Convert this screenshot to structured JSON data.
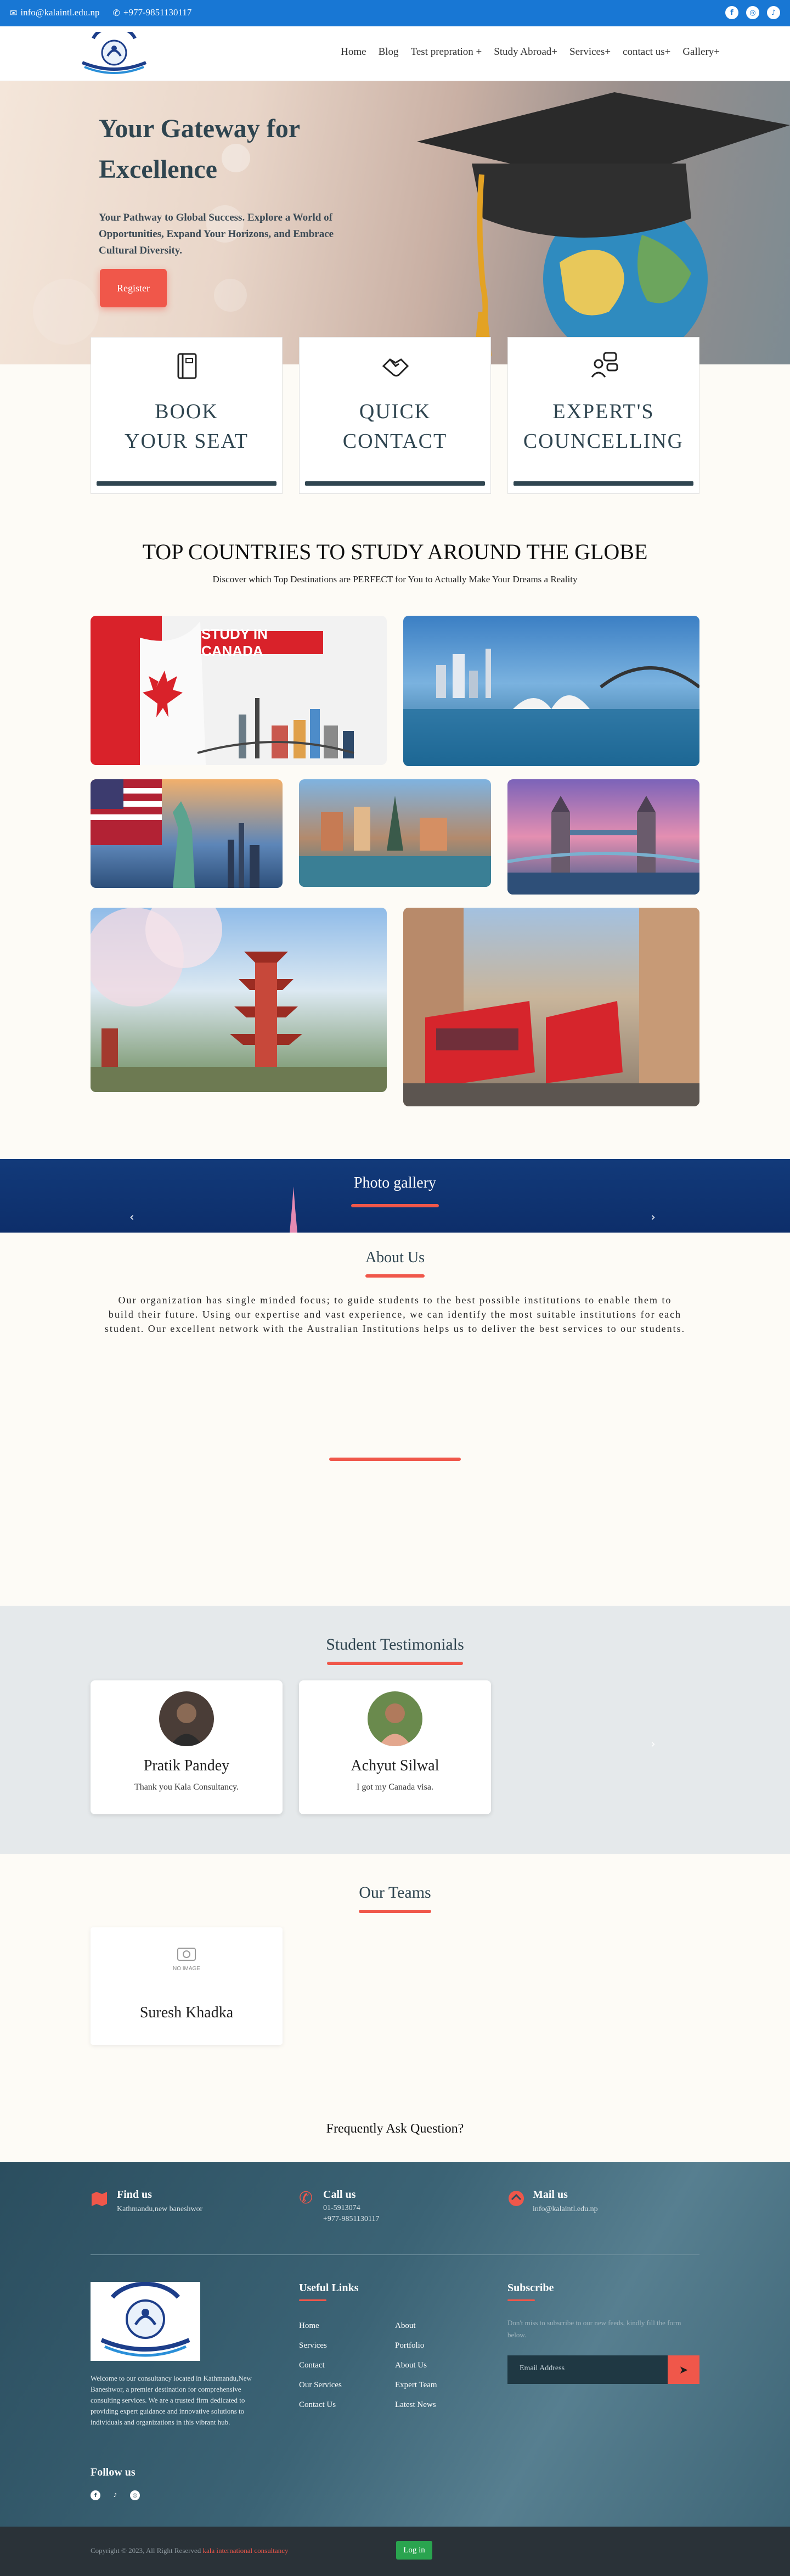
{
  "topbar": {
    "email": "info@kalaintl.edu.np",
    "phone": "+977-9851130117"
  },
  "nav": {
    "items": [
      "Home",
      "Blog",
      "Test prepration +",
      "Study Abroad+",
      "Services+",
      "contact us+",
      "Gallery+"
    ]
  },
  "hero": {
    "title": "Your Gateway for Excellence",
    "subtitle": "Your Pathway to Global Success. Explore a World of Opportunities, Expand Your Horizons, and Embrace Cultural Diversity.",
    "register": "Register"
  },
  "features": [
    {
      "label": "BOOK YOUR SEAT",
      "icon": "book-icon"
    },
    {
      "label": "QUICK CONTACT",
      "icon": "handshake-icon"
    },
    {
      "label": "EXPERT'S COUNCELLING",
      "icon": "counselling-icon"
    }
  ],
  "countries": {
    "title": "TOP COUNTRIES TO STUDY AROUND THE GLOBE",
    "subtitle": "Discover which Top Destinations are PERFECT for You to Actually Make Your Dreams a Reality",
    "canada_banner": "STUDY IN CANADA"
  },
  "gallery": {
    "title": "Photo gallery"
  },
  "about": {
    "title": "About Us",
    "text": "Our organization has single minded focus; to guide students to the best possible institutions to enable them to build their future. Using our expertise and vast experience, we can identify the most suitable institutions for each student. Our excellent network with the Australian Institutions helps us to deliver the best services to our students."
  },
  "testimonials": {
    "title": "Student Testimonials",
    "items": [
      {
        "name": "Pratik Pandey",
        "message": "Thank you Kala Consultancy."
      },
      {
        "name": "Achyut Silwal",
        "message": "I got my Canada visa."
      }
    ]
  },
  "teams": {
    "title": "Our Teams",
    "no_image": "NO IMAGE",
    "members": [
      {
        "name": "Suresh Khadka"
      }
    ]
  },
  "faq": {
    "title": "Frequently Ask Question?"
  },
  "footer": {
    "find_us": {
      "title": "Find us",
      "value": "Kathmandu,new baneshwor"
    },
    "call_us": {
      "title": "Call us",
      "line1": "01-5913074",
      "line2": "+977-9851130117"
    },
    "mail_us": {
      "title": "Mail us",
      "value": "info@kalaintl.edu.np"
    },
    "about_text": "Welcome to our consultancy located in Kathmandu,New Baneshwor, a premier destination for comprehensive consulting services. We are a trusted firm dedicated to providing expert guidance and innovative solutions to individuals and organizations in this vibrant hub.",
    "follow_us": "Follow us",
    "useful_links_title": "Useful Links",
    "links_col1": [
      "Home",
      "Services",
      "Contact",
      "Our Services",
      "Contact Us"
    ],
    "links_col2": [
      "About",
      "Portfolio",
      "About Us",
      "Expert Team",
      "Latest News"
    ],
    "subscribe_title": "Subscribe",
    "subscribe_text": "Don't miss to subscribe to our new feeds, kindly fill the form below.",
    "email_placeholder": "Email Address"
  },
  "copyright": {
    "text": "Copyright © 2023, All Right Reserved",
    "brand": "kala international consultancy",
    "login": "Log in"
  },
  "colors": {
    "topbar": "#1877d4",
    "accent": "#f0574a",
    "dark": "#2f4550",
    "gallery": "#0d2e6a",
    "login": "#2aa44f"
  }
}
